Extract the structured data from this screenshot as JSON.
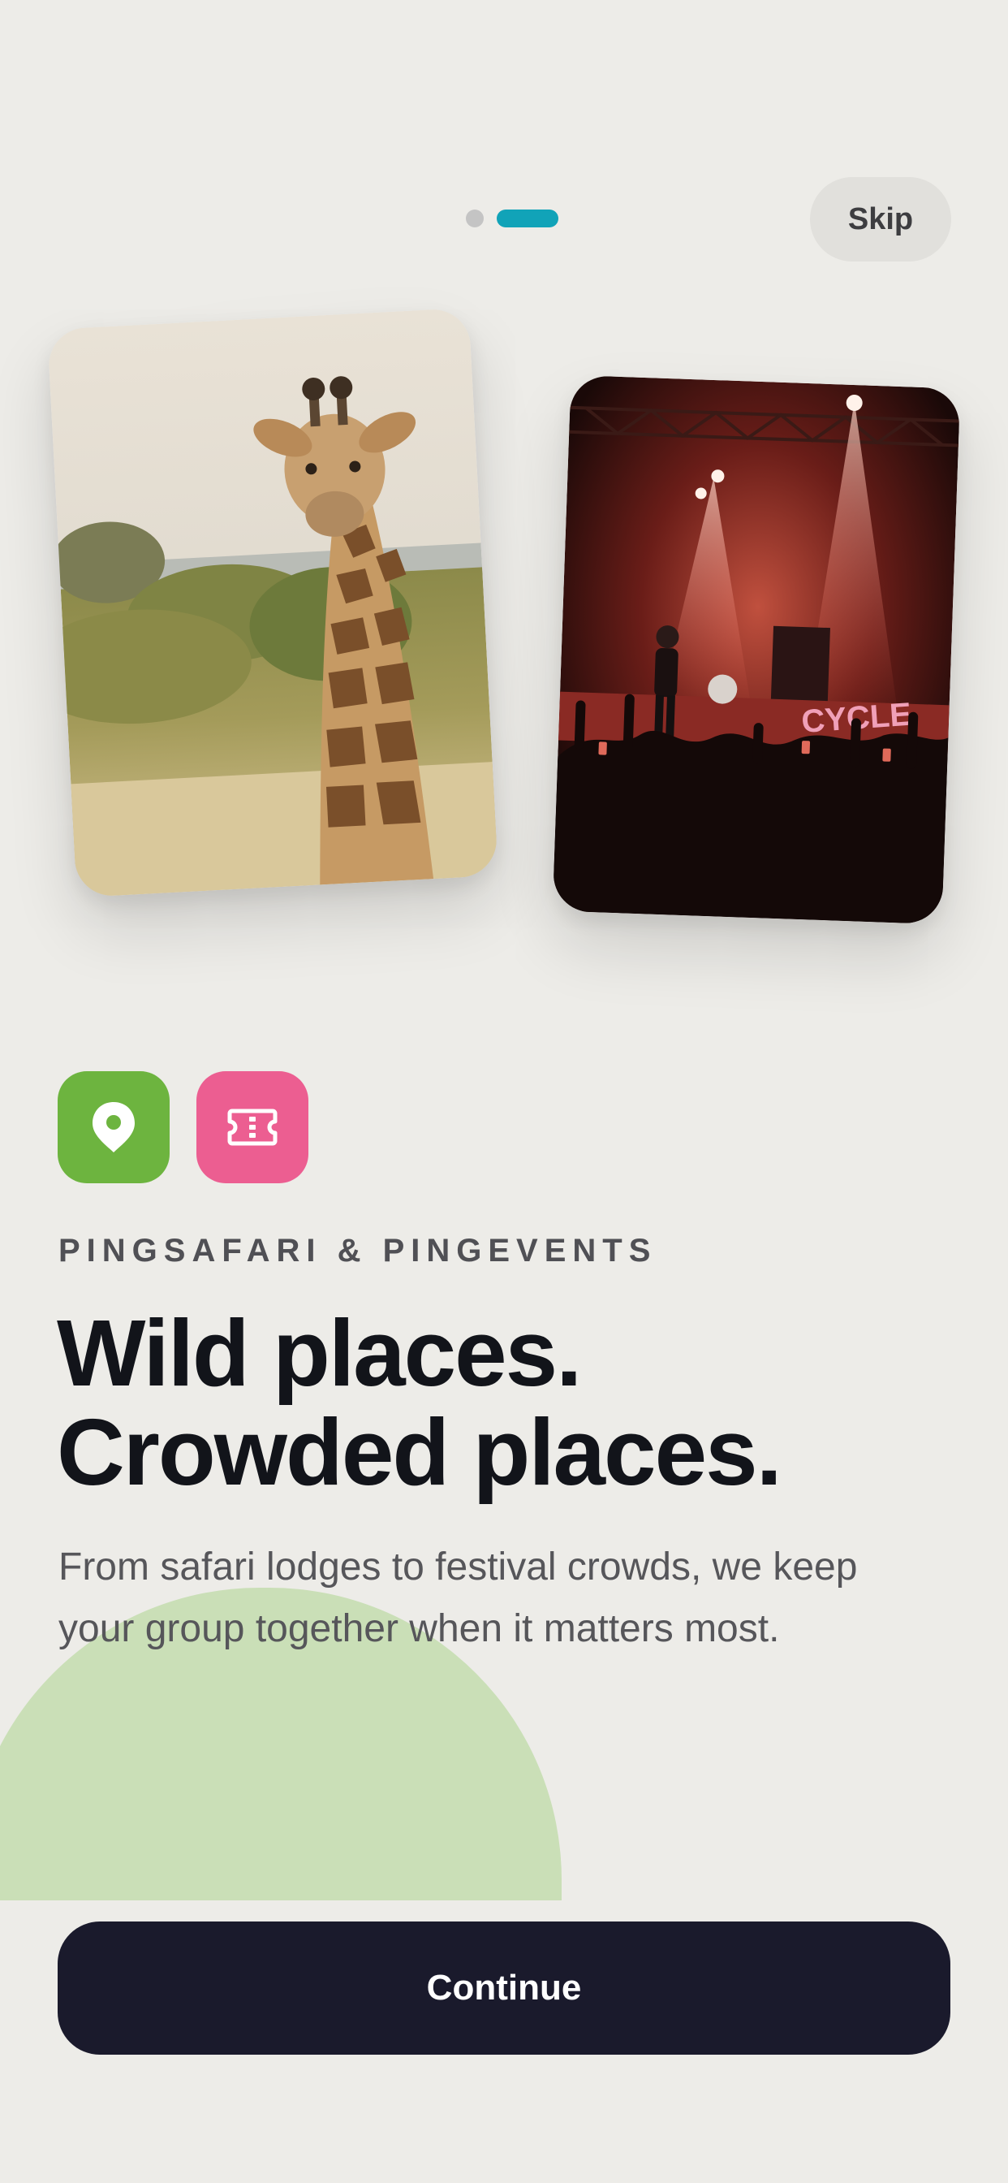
{
  "header": {
    "skip_label": "Skip",
    "pagination": {
      "total": 2,
      "active_index": 1
    }
  },
  "colors": {
    "background": "#edece8",
    "accent_teal": "#11a3b8",
    "inactive_dot": "#c4c4c4",
    "pin_tile": "#6db43f",
    "ticket_tile": "#ec5e91",
    "blob": "#cadfb7",
    "cta": "#1a1a2c"
  },
  "cards": [
    {
      "name": "safari-photo",
      "subject": "giraffe in savanna"
    },
    {
      "name": "concert-photo",
      "subject": "performer on stage with crowd"
    }
  ],
  "icons": [
    "location-pin-icon",
    "ticket-icon"
  ],
  "content": {
    "eyebrow": "PINGSAFARI & PINGEVENTS",
    "headline_line1": "Wild places.",
    "headline_line2": "Crowded places.",
    "body": "From safari lodges to festival crowds, we keep your group together when it matters most."
  },
  "cta": {
    "label": "Continue"
  }
}
